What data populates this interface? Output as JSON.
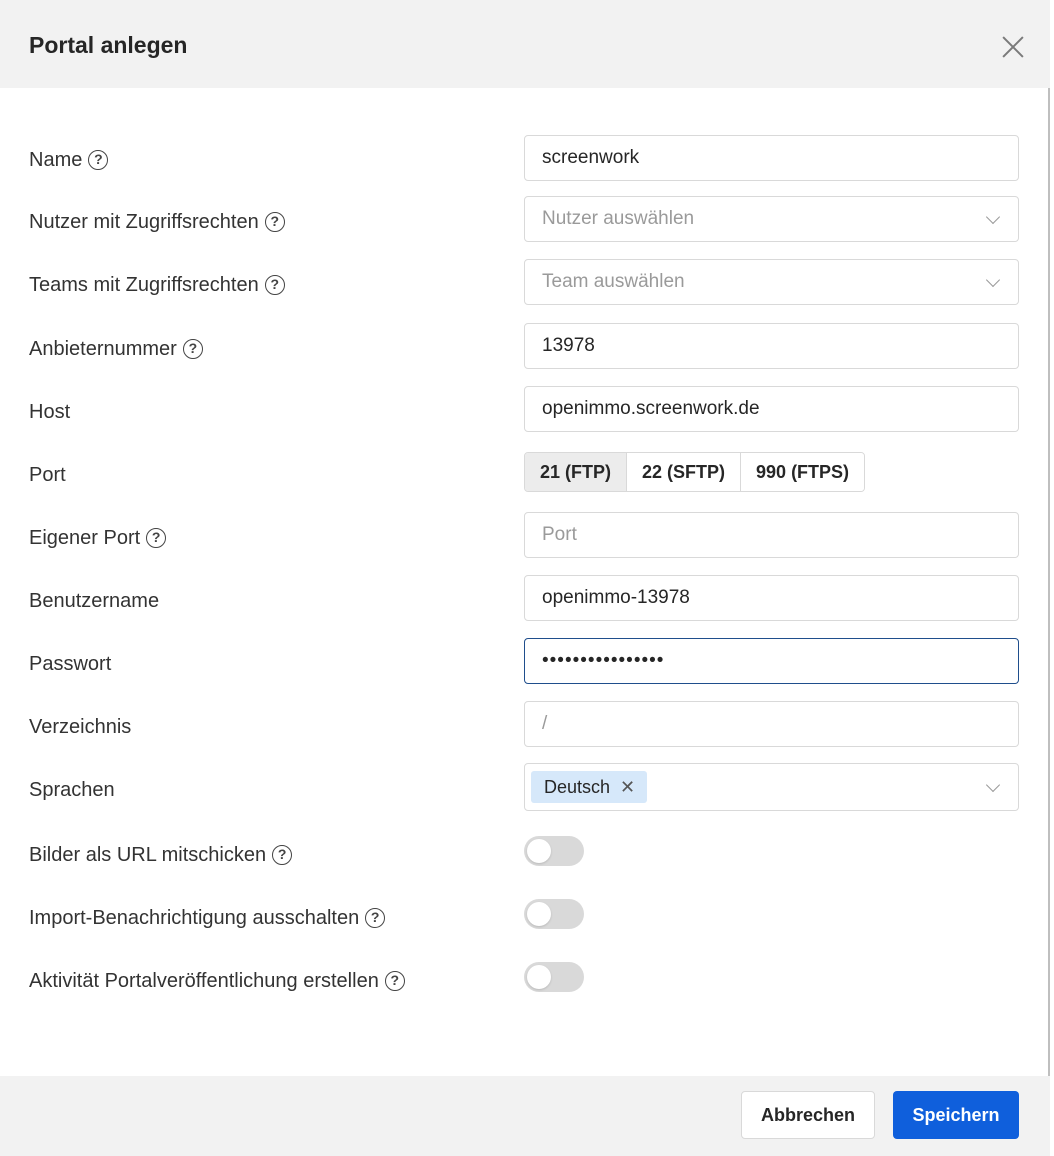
{
  "dialog": {
    "title": "Portal anlegen"
  },
  "fields": {
    "name": {
      "label": "Name",
      "value": "screenwork"
    },
    "users": {
      "label": "Nutzer mit Zugriffsrechten",
      "placeholder": "Nutzer auswählen"
    },
    "teams": {
      "label": "Teams mit Zugriffsrechten",
      "placeholder": "Team auswählen"
    },
    "provider_number": {
      "label": "Anbieternummer",
      "value": "13978"
    },
    "host": {
      "label": "Host",
      "value": "openimmo.screenwork.de"
    },
    "port": {
      "label": "Port",
      "options": [
        "21 (FTP)",
        "22 (SFTP)",
        "990 (FTPS)"
      ],
      "selected": "21 (FTP)"
    },
    "custom_port": {
      "label": "Eigener Port",
      "placeholder": "Port"
    },
    "username": {
      "label": "Benutzername",
      "value": "openimmo-13978"
    },
    "password": {
      "label": "Passwort",
      "value": "••••••••••••••••"
    },
    "directory": {
      "label": "Verzeichnis",
      "placeholder": "/"
    },
    "languages": {
      "label": "Sprachen",
      "tags": [
        "Deutsch"
      ]
    },
    "send_images_url": {
      "label": "Bilder als URL mitschicken",
      "enabled": false
    },
    "disable_import_notification": {
      "label": "Import-Benachrichtigung ausschalten",
      "enabled": false
    },
    "create_activity": {
      "label": "Aktivität Portalveröffentlichung erstellen",
      "enabled": false
    }
  },
  "icons": {
    "help": "question-circle-icon",
    "close": "close-icon",
    "chevron": "chevron-down-icon",
    "tag_remove": "close-small-icon"
  },
  "colors": {
    "primary": "#0f5fdc",
    "header_bg": "#f2f2f2",
    "tag_bg": "#d6e8fa",
    "focus_border": "#1f4e8c"
  },
  "footer": {
    "cancel_label": "Abbrechen",
    "save_label": "Speichern"
  }
}
